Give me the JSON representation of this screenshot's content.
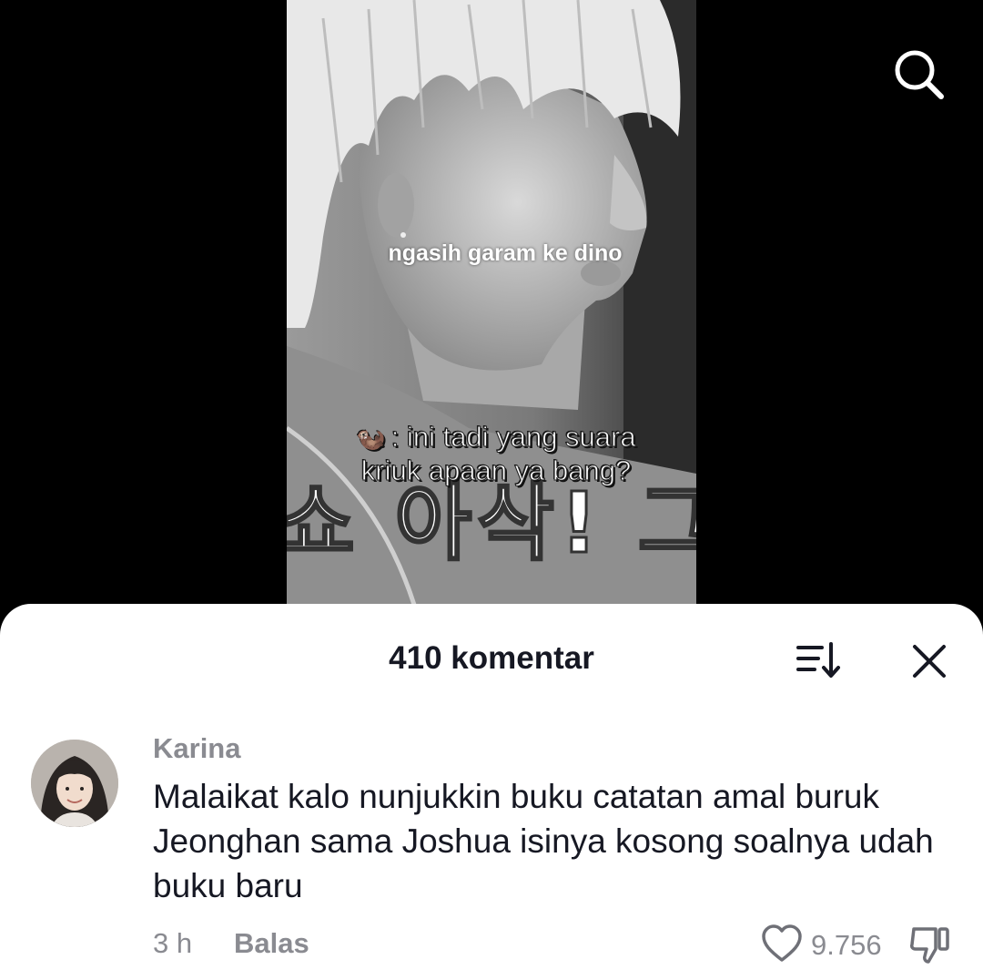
{
  "video": {
    "caption_top": "ngasih garam ke dino",
    "caption_bottom_emoji": "🦦",
    "caption_bottom_line1": ": ini tadi yang suara",
    "caption_bottom_line2": "kriuk apaan ya bang?",
    "korean_subtitle": "쇼 아삭! 그거"
  },
  "header": {
    "search_icon": "search-icon"
  },
  "comments_sheet": {
    "title": "410 komentar",
    "sort_icon": "sort-icon",
    "close_icon": "close-icon"
  },
  "comment": {
    "username": "Karina",
    "text": "Malaikat kalo nunjukkin buku catatan amal buruk Jeonghan sama Joshua isinya kosong soalnya udah buku baru",
    "time": "3 h",
    "reply_label": "Balas",
    "like_count": "9.756",
    "like_icon": "heart-icon",
    "dislike_icon": "thumbs-down-icon"
  },
  "colors": {
    "sheet_background": "#ffffff",
    "primary_text": "#161823",
    "secondary_text": "#8a8b91",
    "video_backdrop": "#000000"
  }
}
